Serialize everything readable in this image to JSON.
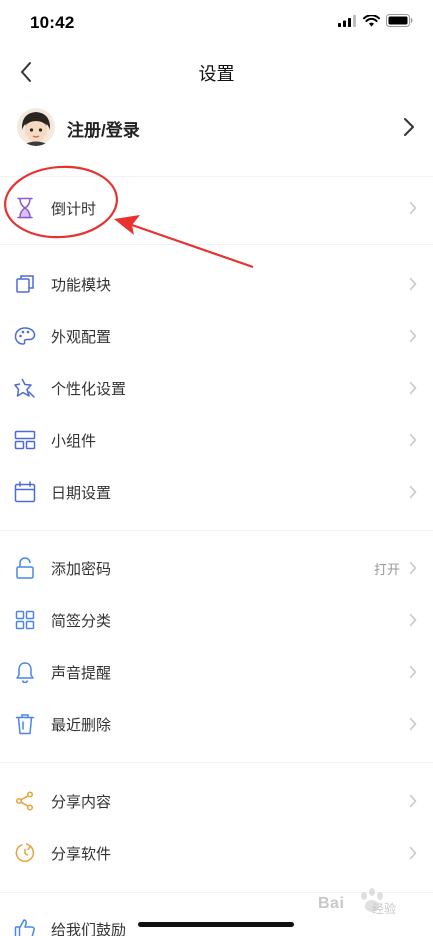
{
  "status_bar": {
    "time": "10:42",
    "icons": [
      "signal-icon",
      "wifi-icon",
      "battery-icon"
    ]
  },
  "nav": {
    "title": "设置",
    "back_icon": "chevron-left-icon"
  },
  "account": {
    "label": "注册/登录",
    "avatar_icon": "avatar",
    "chevron_icon": "chevron-right-icon"
  },
  "groups": [
    {
      "items": [
        {
          "label": "倒计时",
          "icon": "hourglass-icon",
          "icon_color": "#8e5bd0"
        }
      ]
    },
    {
      "items": [
        {
          "label": "功能模块",
          "icon": "module-icon",
          "icon_color": "#4a6bd6"
        },
        {
          "label": "外观配置",
          "icon": "palette-icon",
          "icon_color": "#4a6bd6"
        },
        {
          "label": "个性化设置",
          "icon": "star-icon",
          "icon_color": "#4a6bd6"
        },
        {
          "label": "小组件",
          "icon": "widget-icon",
          "icon_color": "#4a6bd6"
        },
        {
          "label": "日期设置",
          "icon": "calendar-icon",
          "icon_color": "#4a6bd6"
        }
      ]
    },
    {
      "items": [
        {
          "label": "添加密码",
          "icon": "lock-icon",
          "icon_color": "#4a86e8",
          "value": "打开"
        },
        {
          "label": "简签分类",
          "icon": "grid-icon",
          "icon_color": "#4a86e8"
        },
        {
          "label": "声音提醒",
          "icon": "bell-icon",
          "icon_color": "#4a86e8"
        },
        {
          "label": "最近删除",
          "icon": "trash-icon",
          "icon_color": "#4a86e8"
        }
      ]
    },
    {
      "items": [
        {
          "label": "分享内容",
          "icon": "share-icon",
          "icon_color": "#e8a33c"
        },
        {
          "label": "分享软件",
          "icon": "refresh-icon",
          "icon_color": "#e8a33c"
        }
      ]
    },
    {
      "items": [
        {
          "label": "给我们鼓励",
          "icon": "thumbs-up-icon",
          "icon_color": "#4a86e8"
        }
      ]
    }
  ],
  "annotation": {
    "color": "#e8322f",
    "shapes": [
      "highlight-ellipse",
      "pointer-arrow"
    ]
  },
  "watermark": {
    "text": "Bai",
    "sub": "经验"
  },
  "colors": {
    "chevron": "#c7c7cc",
    "divider": "#f2f2f2",
    "text": "#333333",
    "value": "#999999"
  }
}
